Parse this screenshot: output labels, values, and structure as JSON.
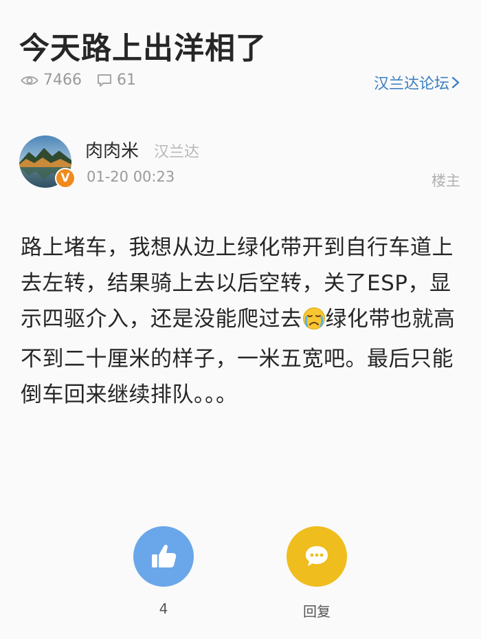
{
  "post": {
    "title": "今天路上出洋相了",
    "views": "7466",
    "comments": "61",
    "forum": "汉兰达论坛"
  },
  "author": {
    "name": "肉肉米",
    "tag": "汉兰达",
    "time": "01-20 00:23",
    "badge": "V",
    "floor": "楼主"
  },
  "content": {
    "text_before_emoji": "路上堵车，我想从边上绿化带开到自行车道上去左转，结果骑上去以后空转，关了ESP，显示四驱介入，还是没能爬过去",
    "emoji": "crying-face-emoji",
    "text_after_emoji": "绿化带也就高不到二十厘米的样子，一米五宽吧。最后只能倒车回来继续排队。。。"
  },
  "actions": {
    "like_count": "4",
    "reply_label": "回复"
  },
  "colors": {
    "accent": "#3b7fc4",
    "like_button": "#6aa6ea",
    "reply_button": "#efbd1e",
    "verified_badge": "#f08a1c"
  }
}
